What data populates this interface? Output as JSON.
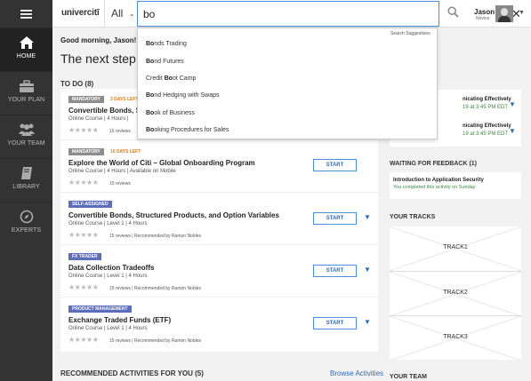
{
  "nav": {
    "items": [
      {
        "label": "HOME",
        "icon": "home-icon"
      },
      {
        "label": "YOUR PLAN",
        "icon": "briefcase-icon"
      },
      {
        "label": "YOUR TEAM",
        "icon": "team-icon"
      },
      {
        "label": "LIBRARY",
        "icon": "book-icon"
      },
      {
        "label": "EXPERTS",
        "icon": "compass-icon"
      }
    ]
  },
  "header": {
    "logo": "univercitī",
    "scope": "All",
    "search_value": "bo",
    "user_name": "Jason",
    "user_role": "Novice"
  },
  "search": {
    "header": "Search Suggestions",
    "suggestions": [
      {
        "pre": "",
        "match": "Bo",
        "post": "nds Trading"
      },
      {
        "pre": "",
        "match": "Bo",
        "post": "nd Futures"
      },
      {
        "pre": "Credit ",
        "match": "Bo",
        "post": "ot Camp"
      },
      {
        "pre": "",
        "match": "Bo",
        "post": "nd Hedging with Swaps"
      },
      {
        "pre": "",
        "match": "Bo",
        "post": "ok of Business"
      },
      {
        "pre": "",
        "match": "Bo",
        "post": "oking Procedures for Sales"
      }
    ]
  },
  "main": {
    "greeting": "Good morning, Jason!",
    "next_step": "The next step in",
    "todo_header": "TO DO (8)",
    "todo": [
      {
        "tag": "MANDATORY",
        "due": "3 DAYS LEFT",
        "title": "Convertible Bonds, Stru",
        "meta": "Online Course  |  4 Hours  |",
        "stars": "★★★★★",
        "reviews": "15 reviews",
        "start": "",
        "chevron": false
      },
      {
        "tag": "MANDATORY",
        "due": "10 DAYS LEFT",
        "title": "Explore the World of Citi – Global Onboarding Program",
        "meta": "Online Course  |  4 Hours  |  Available on Mobile",
        "stars": "★★★★★",
        "reviews": "15 reviews",
        "start": "START",
        "chevron": false
      },
      {
        "tag": "SELF-ASSIGNED",
        "due": "",
        "title": "Convertible Bonds, Structured Products, and Option Variables",
        "meta": "Online Course  |  Level 1  |  4 Hours",
        "stars": "★★★★★",
        "reviews": "15 reviews  |  Recommended by Ramon Nobles",
        "start": "START",
        "chevron": true
      },
      {
        "tag": "FX TRADER",
        "due": "",
        "title": "Data Collection Tradeoffs",
        "meta": "Online Course  |  Level 1  |  4 Hours",
        "stars": "★★★★★",
        "reviews": "15 reviews  |  Recommended by Ramon Nobles",
        "start": "START",
        "chevron": true
      },
      {
        "tag": "PRODUCT MANAGEMENT",
        "due": "",
        "title": "Exchange Traded Funds (ETF)",
        "meta": "Online Course  |  Level 1  |  4 Hours",
        "stars": "★★★★★",
        "reviews": "15 reviews  |  Recommended by Ramon Nobles",
        "start": "START",
        "chevron": true
      }
    ],
    "recommended_header": "RECOMMENDED ACTIVITIES FOR YOU (5)",
    "browse_link": "Browse Activities"
  },
  "right": {
    "upcoming": [
      {
        "title": "nicating Effectively",
        "time": "19 at 3:45 PM EDT"
      },
      {
        "title": "nicating Effectively",
        "time": "19 at 3:45 PM EDT"
      }
    ],
    "waiting_header": "WAITING FOR FEEDBACK (1)",
    "waiting": {
      "title": "Introduction to Application Security",
      "sub": "You completed this activity on Sunday"
    },
    "tracks_header": "YOUR TRACKS",
    "tracks": [
      "TRACK1",
      "TRACK2",
      "TRACK3"
    ],
    "team_header": "YOUR TEAM"
  },
  "colors": {
    "accent": "#2a6cb5",
    "nav_bg": "#333333",
    "due_orange": "#e07d10",
    "success_green": "#3a8a3a",
    "tag_blue": "#5b6dbb",
    "tag_grey": "#8c8c8c"
  }
}
